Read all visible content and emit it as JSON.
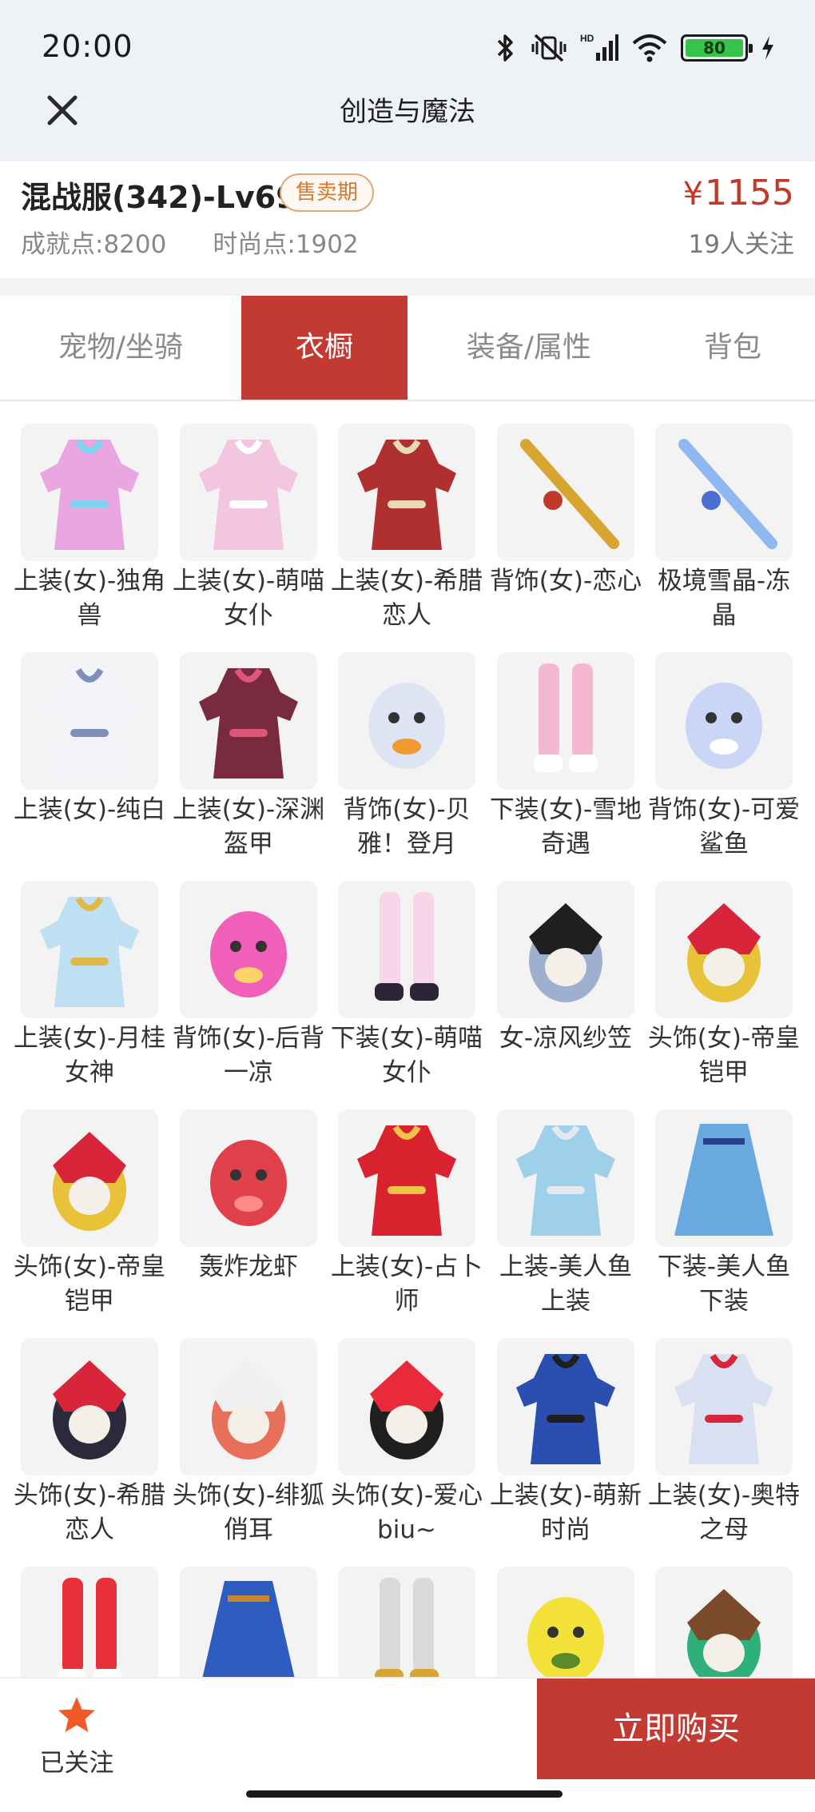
{
  "status_bar": {
    "time": "20:00",
    "battery": "80",
    "network_badge": "HD"
  },
  "nav": {
    "title": "创造与魔法",
    "close_icon": "close-icon"
  },
  "listing": {
    "title": "混战服(342)-Lv69",
    "badge": "售卖期",
    "achievement_label": "成就点:",
    "achievement_value": "8200",
    "fashion_label": "时尚点:",
    "fashion_value": "1902",
    "currency": "¥",
    "price": "1155",
    "followers": "19人关注"
  },
  "tabs": [
    {
      "label": "宠物/坐骑",
      "active": false
    },
    {
      "label": "衣橱",
      "active": true
    },
    {
      "label": "装备/属性",
      "active": false
    },
    {
      "label": "背包",
      "active": false
    }
  ],
  "items": [
    {
      "label": "上装(女)-独角兽",
      "icon": "rainbow-winged-outfit-icon",
      "color": "#e9a6e0",
      "accent": "#7fd3f0"
    },
    {
      "label": "上装(女)-萌喵女仆",
      "icon": "maid-dress-icon",
      "color": "#f2c6e0",
      "accent": "#ffffff"
    },
    {
      "label": "上装(女)-希腊恋人",
      "icon": "greek-dress-icon",
      "color": "#b03030",
      "accent": "#e8d9b8"
    },
    {
      "label": "背饰(女)-恋心",
      "icon": "golden-laurel-icon",
      "color": "#d9a531",
      "accent": "#c0392b"
    },
    {
      "label": "极境雪晶-冻晶",
      "icon": "ice-crystal-sword-icon",
      "color": "#8fb8f0",
      "accent": "#4a6fd1"
    },
    {
      "label": "上装(女)-纯白",
      "icon": "white-gown-icon",
      "color": "#f2f4fa",
      "accent": "#7f8fb8"
    },
    {
      "label": "上装(女)-深渊盔甲",
      "icon": "abyss-armor-icon",
      "color": "#7a2a3e",
      "accent": "#e0557a"
    },
    {
      "label": "背饰(女)-贝雅！登月",
      "icon": "astronaut-bunny-icon",
      "color": "#dfe4f5",
      "accent": "#f09a32"
    },
    {
      "label": "下装(女)-雪地奇遇",
      "icon": "pink-leggings-icon",
      "color": "#f4b8d0",
      "accent": "#ffffff"
    },
    {
      "label": "背饰(女)-可爱鲨鱼",
      "icon": "cute-shark-icon",
      "color": "#c9d6f5",
      "accent": "#ffffff"
    },
    {
      "label": "上装(女)-月桂女神",
      "icon": "laurel-goddess-icon",
      "color": "#bfe0f2",
      "accent": "#e0b84a"
    },
    {
      "label": "背饰(女)-后背一凉",
      "icon": "ice-cream-icon",
      "color": "#f060b8",
      "accent": "#ffd36b"
    },
    {
      "label": "下装(女)-萌喵女仆",
      "icon": "maid-stockings-icon",
      "color": "#f6d6e8",
      "accent": "#2e2438"
    },
    {
      "label": "女-凉风纱笠",
      "icon": "veil-hat-icon",
      "color": "#9fb0cf",
      "accent": "#1f1f1f"
    },
    {
      "label": "头饰(女)-帝皇铠甲",
      "icon": "emperor-helmet-icon",
      "color": "#e8c33a",
      "accent": "#d8253a"
    },
    {
      "label": "头饰(女)-帝皇铠甲",
      "icon": "emperor-helmet-icon",
      "color": "#e8c33a",
      "accent": "#d8253a"
    },
    {
      "label": "轰炸龙虾",
      "icon": "lobster-icon",
      "color": "#e0404a",
      "accent": "#ff8a8a"
    },
    {
      "label": "上装(女)-占卜师",
      "icon": "fortune-teller-dress-icon",
      "color": "#d8232f",
      "accent": "#f2c24a"
    },
    {
      "label": "上装-美人鱼上装",
      "icon": "mermaid-top-icon",
      "color": "#9fd0ea",
      "accent": "#e6e8ef"
    },
    {
      "label": "下装-美人鱼下装",
      "icon": "mermaid-skirt-icon",
      "color": "#6aa8e0",
      "accent": "#2d3f8f"
    },
    {
      "label": "头饰(女)-希腊恋人",
      "icon": "rose-crown-icon",
      "color": "#2a2a3c",
      "accent": "#d8253a"
    },
    {
      "label": "头饰(女)-绯狐俏耳",
      "icon": "fox-ears-icon",
      "color": "#e8705a",
      "accent": "#f0f0f0"
    },
    {
      "label": "头饰(女)-爱心biu~",
      "icon": "heart-headband-icon",
      "color": "#1f1f1f",
      "accent": "#e82a3a"
    },
    {
      "label": "上装(女)-萌新时尚",
      "icon": "blue-qipao-icon",
      "color": "#2a4fb0",
      "accent": "#1f1f1f"
    },
    {
      "label": "上装(女)-奥特之母",
      "icon": "ultra-suit-icon",
      "color": "#d8e0f2",
      "accent": "#d8253a"
    },
    {
      "label": "",
      "icon": "red-boots-icon",
      "color": "#e8303a",
      "accent": "#ffffff"
    },
    {
      "label": "",
      "icon": "blue-skirt-icon",
      "color": "#2f5cc0",
      "accent": "#c8862a"
    },
    {
      "label": "",
      "icon": "golden-sandals-icon",
      "color": "#d9d9d9",
      "accent": "#d9a531"
    },
    {
      "label": "",
      "icon": "banana-pet-icon",
      "color": "#f4e23a",
      "accent": "#5a8a2a"
    },
    {
      "label": "",
      "icon": "green-leaf-hat-icon",
      "color": "#2fb07a",
      "accent": "#7a4a2a"
    }
  ],
  "bottom_bar": {
    "follow_label": "已关注",
    "buy_label": "立即购买",
    "follow_icon": "star-icon",
    "star_color": "#f05a28"
  }
}
